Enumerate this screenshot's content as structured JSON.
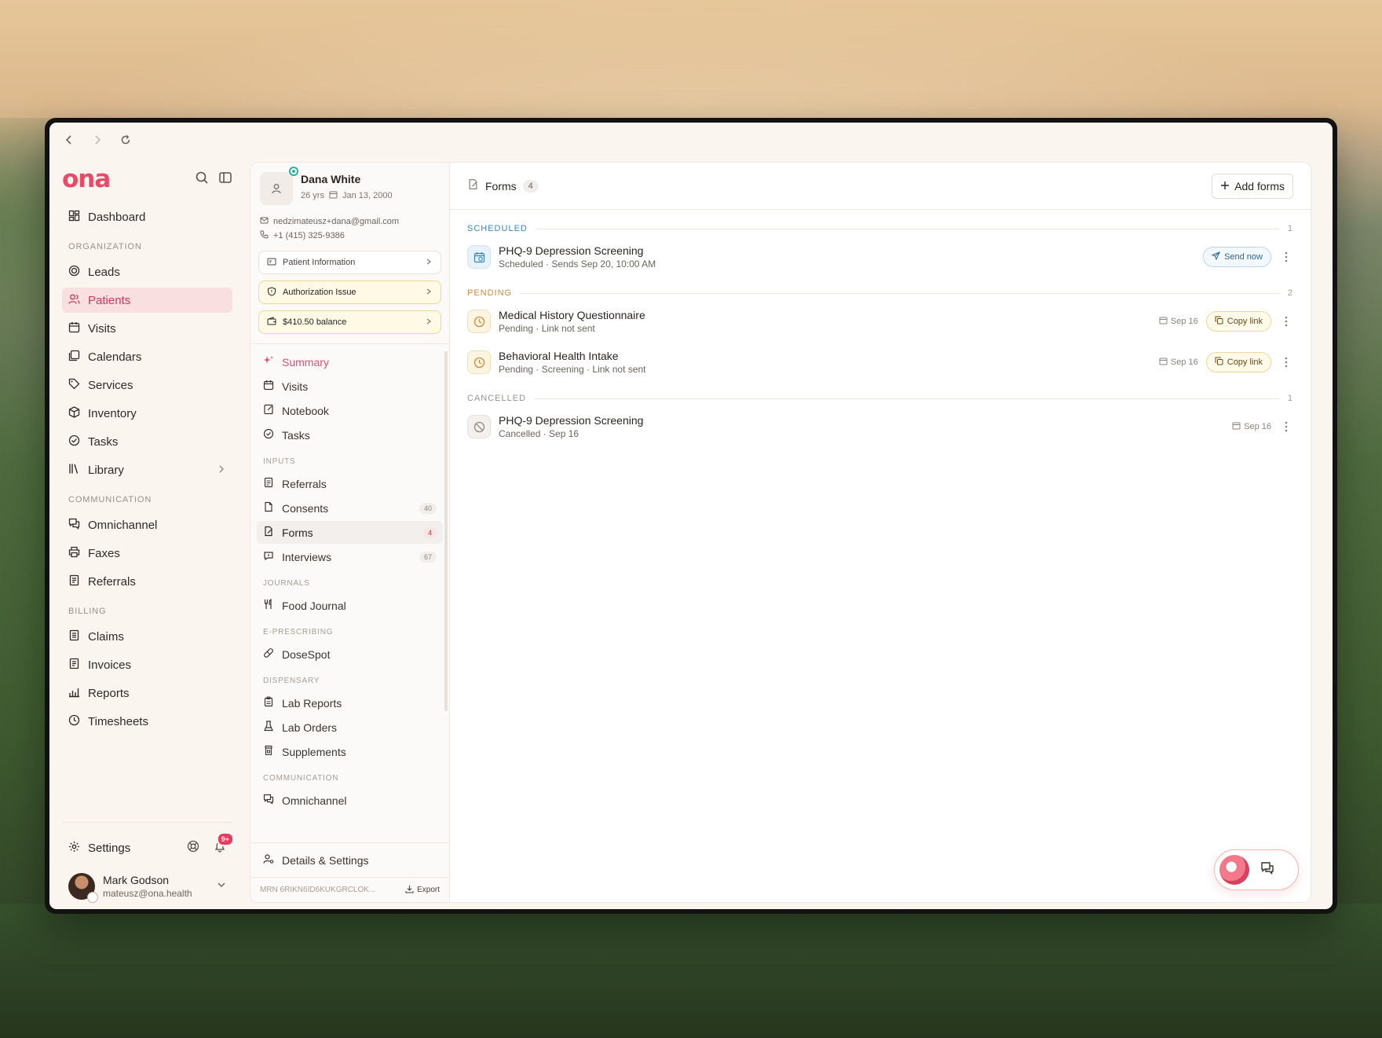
{
  "sidebar": {
    "logo": "ona",
    "items_top": [
      {
        "label": "Dashboard",
        "icon": "dashboard-icon"
      }
    ],
    "section_org": "ORGANIZATION",
    "org_items": [
      {
        "label": "Leads"
      },
      {
        "label": "Patients"
      },
      {
        "label": "Visits"
      },
      {
        "label": "Calendars"
      },
      {
        "label": "Services"
      },
      {
        "label": "Inventory"
      },
      {
        "label": "Tasks"
      },
      {
        "label": "Library"
      }
    ],
    "section_comm": "COMMUNICATION",
    "comm_items": [
      {
        "label": "Omnichannel"
      },
      {
        "label": "Faxes"
      },
      {
        "label": "Referrals"
      }
    ],
    "section_billing": "BILLING",
    "billing_items": [
      {
        "label": "Claims"
      },
      {
        "label": "Invoices"
      },
      {
        "label": "Reports"
      },
      {
        "label": "Timesheets"
      }
    ],
    "settings_label": "Settings",
    "notif_badge": "9+",
    "user": {
      "name": "Mark Godson",
      "email": "mateusz@ona.health"
    }
  },
  "patient": {
    "name": "Dana White",
    "age": "26 yrs",
    "dob": "Jan 13, 2000",
    "email": "nedzimateusz+dana@gmail.com",
    "phone": "+1 (415) 325-9386",
    "info_pill": "Patient Information",
    "auth_pill": "Authorization Issue",
    "balance_pill": "$410.50 balance",
    "nav": {
      "summary": "Summary",
      "visits": "Visits",
      "notebook": "Notebook",
      "tasks": "Tasks",
      "section_inputs": "INPUTS",
      "referrals": "Referrals",
      "consents": "Consents",
      "consents_count": "40",
      "forms": "Forms",
      "forms_count": "4",
      "interviews": "Interviews",
      "interviews_count": "67",
      "section_journals": "JOURNALS",
      "food_journal": "Food Journal",
      "section_erx": "E-PRESCRIBING",
      "dosespot": "DoseSpot",
      "section_dispensary": "DISPENSARY",
      "lab_reports": "Lab Reports",
      "lab_orders": "Lab Orders",
      "supplements": "Supplements",
      "section_comm": "COMMUNICATION",
      "omnichannel": "Omnichannel"
    },
    "details_settings": "Details & Settings",
    "mrn": "MRN 6RIKN6ID6KUKGRCLOK...",
    "export": "Export"
  },
  "forms": {
    "title": "Forms",
    "count": "4",
    "add_label": "Add forms",
    "scheduled": {
      "label": "SCHEDULED",
      "count": "1",
      "items": [
        {
          "title": "PHQ-9 Depression Screening",
          "sub": "Scheduled · Sends Sep 20, 10:00 AM",
          "action": "Send now"
        }
      ]
    },
    "pending": {
      "label": "PENDING",
      "count": "2",
      "items": [
        {
          "title": "Medical History Questionnaire",
          "sub": "Pending · Link not sent",
          "date": "Sep 16",
          "action": "Copy link"
        },
        {
          "title": "Behavioral Health Intake",
          "sub": "Pending · Screening · Link not sent",
          "date": "Sep 16",
          "action": "Copy link"
        }
      ]
    },
    "cancelled": {
      "label": "CANCELLED",
      "count": "1",
      "items": [
        {
          "title": "PHQ-9 Depression Screening",
          "sub": "Cancelled · Sep 16",
          "date": "Sep 16"
        }
      ]
    }
  },
  "colors": {
    "brand": "#ea4a67",
    "scheduled": "#3a86b8",
    "pending": "#d08a3c"
  }
}
